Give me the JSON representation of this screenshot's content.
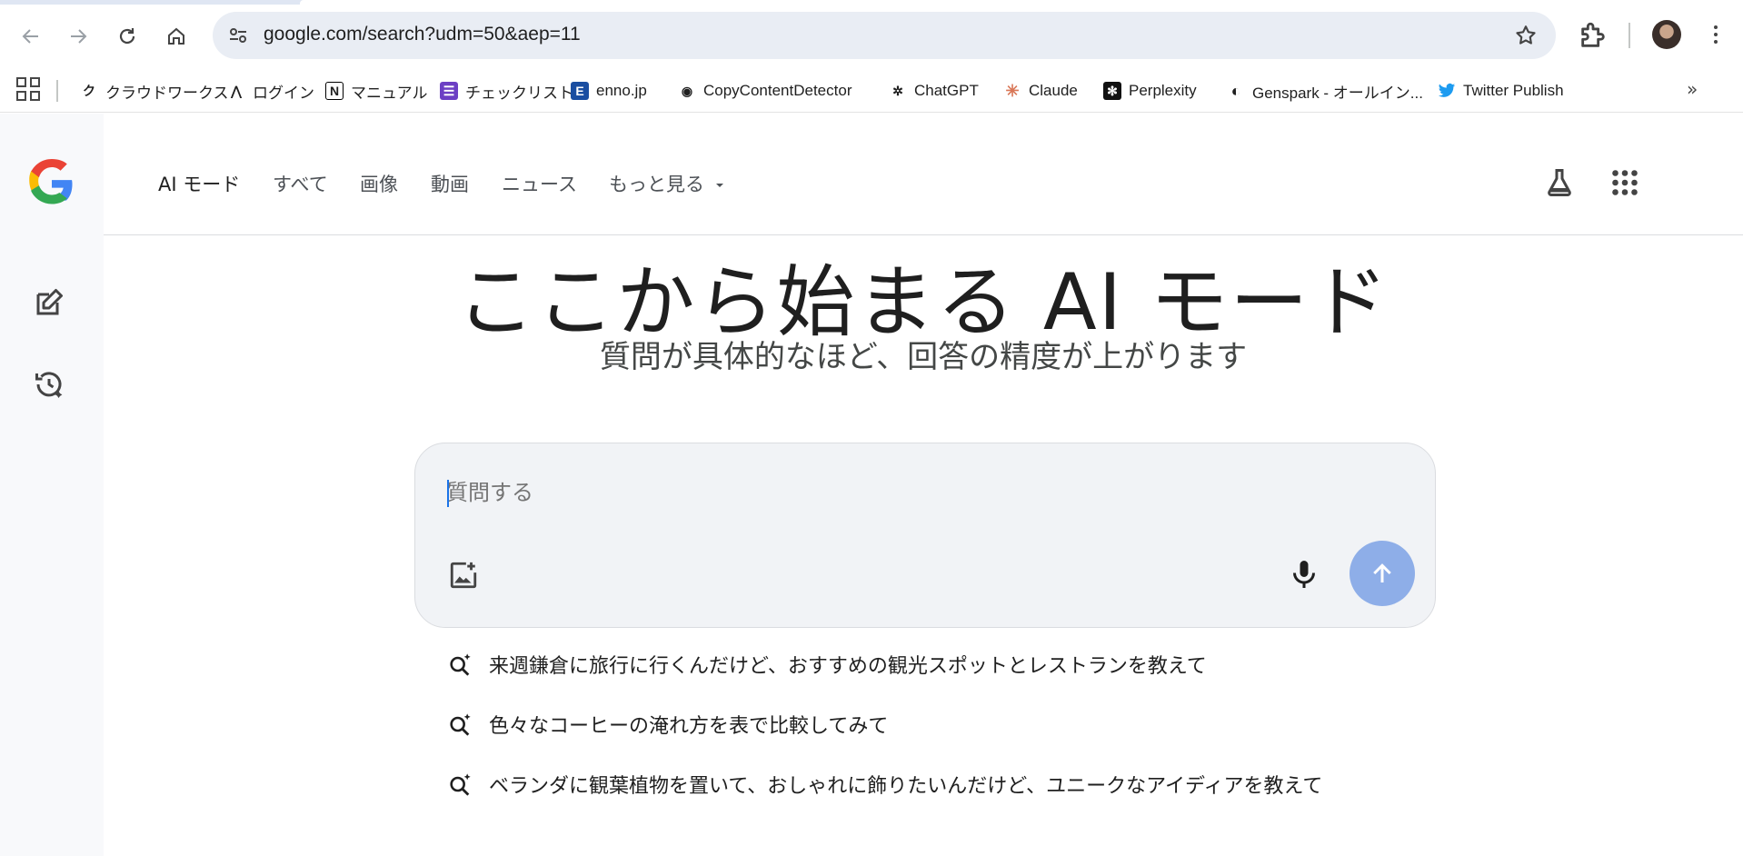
{
  "browser": {
    "url": "google.com/search?udm=50&aep=11",
    "bookmarks": [
      {
        "label": "クラウドワークス",
        "icon": "crowdworks-icon",
        "glyph": "ク",
        "color": "#000000"
      },
      {
        "label": "ログイン",
        "icon": "login-icon",
        "glyph": "⋀",
        "color": "#000000"
      },
      {
        "label": "マニュアル",
        "icon": "notion-icon",
        "glyph": "N",
        "color": "#000000"
      },
      {
        "label": "チェックリスト",
        "icon": "checklist-icon",
        "glyph": "☰",
        "color": "#6c3fc4"
      },
      {
        "label": "enno.jp",
        "icon": "enno-icon",
        "glyph": "E",
        "color": "#1a4ea1"
      },
      {
        "label": "CopyContentDetector",
        "icon": "copycontent-icon",
        "glyph": "◉",
        "color": "#222222"
      },
      {
        "label": "ChatGPT",
        "icon": "chatgpt-icon",
        "glyph": "✲",
        "color": "#333333"
      },
      {
        "label": "Claude",
        "icon": "claude-icon",
        "glyph": "✳",
        "color": "#d97757"
      },
      {
        "label": "Perplexity",
        "icon": "perplexity-icon",
        "glyph": "✻",
        "color": "#111111"
      },
      {
        "label": "Genspark - オールイン...",
        "icon": "genspark-icon",
        "glyph": "◐",
        "color": "#111111"
      },
      {
        "label": "Twitter Publish",
        "icon": "twitter-icon",
        "glyph": "🐦",
        "color": "#1d9bf0"
      }
    ]
  },
  "header": {
    "tabs": [
      {
        "label": "AI モード",
        "active": true
      },
      {
        "label": "すべて",
        "active": false
      },
      {
        "label": "画像",
        "active": false
      },
      {
        "label": "動画",
        "active": false
      },
      {
        "label": "ニュース",
        "active": false
      },
      {
        "label": "もっと見る",
        "active": false
      }
    ]
  },
  "hero": {
    "title": "ここから始まる AI モード",
    "subtitle": "質問が具体的なほど、回答の精度が上がります"
  },
  "ask": {
    "placeholder": "質問する"
  },
  "suggestions": [
    "来週鎌倉に旅行に行くんだけど、おすすめの観光スポットとレストランを教えて",
    "色々なコーヒーの淹れ方を表で比較してみて",
    "ベランダに観葉植物を置いて、おしゃれに飾りたいんだけど、ユニークなアイディアを教えて"
  ],
  "colors": {
    "accent": "#1a73e8",
    "send_button": "#8eaee8",
    "rail_bg": "#f8f9fb",
    "omnibox_bg": "#e9edf4"
  }
}
